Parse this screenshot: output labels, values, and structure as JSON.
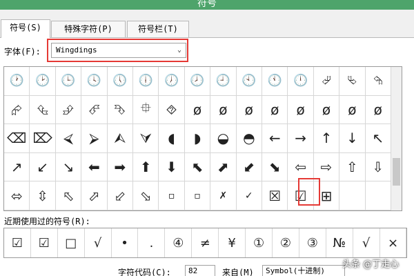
{
  "window": {
    "title": "符号"
  },
  "tabs": [
    {
      "label": "符号(S)"
    },
    {
      "label": "特殊字符(P)"
    },
    {
      "label": "符号栏(T)"
    }
  ],
  "font": {
    "label": "字体(F):",
    "value": "Wingdings"
  },
  "symbols": [
    [
      "🕐",
      "🕑",
      "🕒",
      "🕓",
      "🕔",
      "🕕",
      "🕖",
      "🕗",
      "🕘",
      "🕙",
      "🕚",
      "🕛",
      "⮰",
      "⮱",
      "⮲"
    ],
    [
      "⮳",
      "⮴",
      "⮵",
      "⮶",
      "⮷",
      "⯐",
      "⯑",
      "ø",
      "ø",
      "ø",
      "ø",
      "ø",
      "ø",
      "ø",
      "ø"
    ],
    [
      "⌫",
      "⌦",
      "⮘",
      "⮚",
      "⮙",
      "⮛",
      "◖",
      "◗",
      "◒",
      "◓",
      "←",
      "→",
      "↑",
      "↓",
      "↖"
    ],
    [
      "↗",
      "↙",
      "↘",
      "⬅",
      "➡",
      "⬆",
      "⬇",
      "⬉",
      "⬈",
      "⬋",
      "⬊",
      "⇦",
      "⇨",
      "⇧",
      "⇩"
    ],
    [
      "⬄",
      "⇳",
      "⬁",
      "⬀",
      "⬃",
      "⬂",
      "▫",
      "▫",
      "✗",
      "✓",
      "☒",
      "☑",
      "⊞",
      "",
      ""
    ]
  ],
  "recent": {
    "label": "近期使用过的符号(R):",
    "items": [
      "☑",
      "☑",
      "□",
      "√",
      "•",
      ".",
      "④",
      "≠",
      "¥",
      "①",
      "②",
      "③",
      "№",
      "√",
      "×"
    ]
  },
  "charcode": {
    "label": "字符代码(C):",
    "value": "82"
  },
  "from": {
    "label": "来自(M)",
    "value": "Symbol(十进制)"
  },
  "watermark": "头条 @丁走心"
}
